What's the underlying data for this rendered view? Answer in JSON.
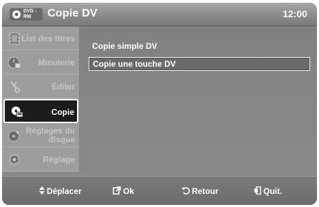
{
  "header": {
    "disc_badge": "DVD -RW",
    "title": "Copie DV",
    "time": "12:00"
  },
  "sidebar": {
    "items": [
      {
        "label": "List des titres",
        "icon": "film-strip-icon",
        "active": false
      },
      {
        "label": "Minuterie",
        "icon": "timer-icon",
        "active": false
      },
      {
        "label": "Éditer",
        "icon": "scissors-icon",
        "active": false
      },
      {
        "label": "Copie",
        "icon": "copy-icon",
        "active": true
      },
      {
        "label": "Réglages du disque",
        "icon": "disc-settings-icon",
        "active": false
      },
      {
        "label": "Réglage",
        "icon": "gear-icon",
        "active": false
      }
    ]
  },
  "content": {
    "options": [
      {
        "label": "Copie simple DV",
        "selected": false
      },
      {
        "label": "Copie une touche DV",
        "selected": true
      }
    ]
  },
  "footer": {
    "move": "Déplacer",
    "ok": "Ok",
    "back": "Retour",
    "quit": "Quit."
  }
}
